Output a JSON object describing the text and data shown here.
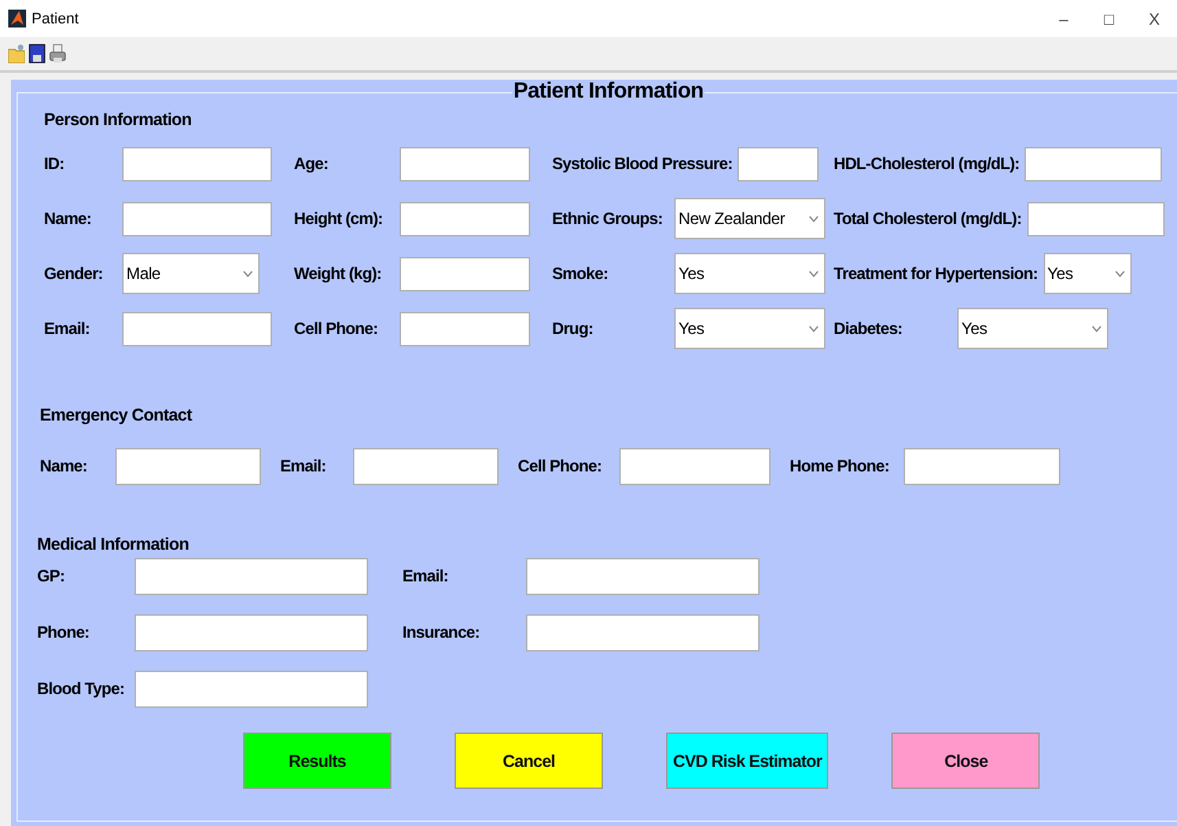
{
  "window": {
    "title": "Patient",
    "controls": [
      "–",
      "□",
      "X"
    ]
  },
  "panel": {
    "title": "Patient Information"
  },
  "person": {
    "heading": "Person Information",
    "rows": [
      [
        {
          "label": "ID:",
          "kind": "text"
        },
        {
          "label": "Age:",
          "kind": "text"
        },
        {
          "label": "Systolic Blood Pressure:",
          "kind": "text"
        },
        {
          "label": "HDL-Cholesterol (mg/dL):",
          "kind": "text"
        }
      ],
      [
        {
          "label": "Name:",
          "kind": "text"
        },
        {
          "label": "Height (cm):",
          "kind": "text"
        },
        {
          "label": "Ethnic Groups:",
          "kind": "select",
          "value": "New Zealander"
        },
        {
          "label": "Total Cholesterol (mg/dL):",
          "kind": "text"
        }
      ],
      [
        {
          "label": "Gender:",
          "kind": "select",
          "value": "Male"
        },
        {
          "label": "Weight (kg):",
          "kind": "text"
        },
        {
          "label": "Smoke:",
          "kind": "select",
          "value": "Yes"
        },
        {
          "label": "Treatment for Hypertension:",
          "kind": "select",
          "value": "Yes"
        }
      ],
      [
        {
          "label": "Email:",
          "kind": "text"
        },
        {
          "label": "Cell Phone:",
          "kind": "text"
        },
        {
          "label": "Drug:",
          "kind": "select",
          "value": "Yes"
        },
        {
          "label": "Diabetes:",
          "kind": "select",
          "value": "Yes"
        }
      ]
    ]
  },
  "emergency": {
    "heading": "Emergency Contact",
    "fields": [
      {
        "label": "Name:",
        "kind": "text"
      },
      {
        "label": "Email:",
        "kind": "text"
      },
      {
        "label": "Cell Phone:",
        "kind": "text"
      },
      {
        "label": "Home Phone:",
        "kind": "text"
      }
    ]
  },
  "medical": {
    "heading": "Medical Information",
    "rows": [
      [
        {
          "label": "GP:",
          "kind": "text"
        },
        {
          "label": "Email:",
          "kind": "text"
        }
      ],
      [
        {
          "label": "Phone:",
          "kind": "text"
        },
        {
          "label": "Insurance:",
          "kind": "text"
        }
      ],
      [
        {
          "label": "Blood Type:",
          "kind": "text"
        }
      ]
    ]
  },
  "buttons": [
    {
      "label": "Results",
      "color": "#00ff00"
    },
    {
      "label": "Cancel",
      "color": "#ffff00"
    },
    {
      "label": "CVD Risk Estimator",
      "color": "#00ffff"
    },
    {
      "label": "Close",
      "color": "#ff99cc"
    }
  ]
}
